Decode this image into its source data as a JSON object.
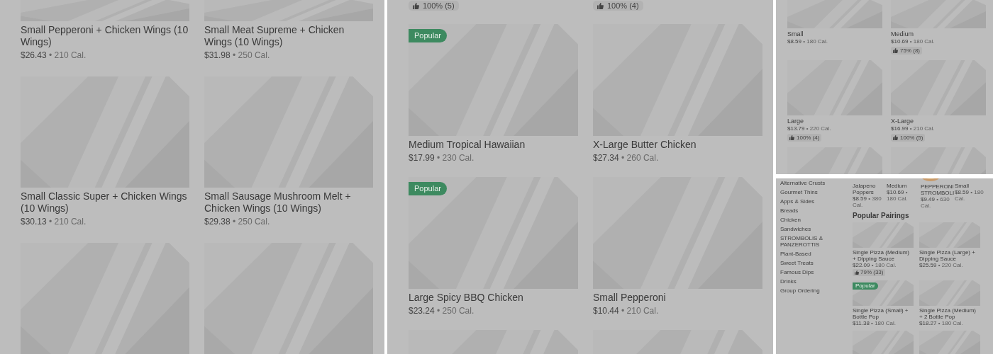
{
  "panels": [
    {
      "kind": "grid",
      "rows": [
        [
          {
            "kind": "card",
            "name": "Small Pepperoni + Chicken Wings (10 Wings)",
            "price": "$26.43",
            "calories": "• 210 Cal."
          },
          {
            "kind": "card",
            "name": "Small Meat Supreme + Chicken Wings (10 Wings)",
            "price": "$31.98",
            "calories": "• 250 Cal."
          }
        ],
        [
          {
            "kind": "card",
            "name": "Small Classic Super + Chicken Wings (10 Wings)",
            "price": "$30.13",
            "calories": "• 210 Cal."
          },
          {
            "kind": "card",
            "name": "Small Sausage Mushroom Melt + Chicken Wings (10 Wings)",
            "price": "$29.38",
            "calories": "• 250 Cal."
          }
        ],
        [
          {
            "kind": "image_only"
          },
          {
            "kind": "image_only"
          }
        ]
      ]
    },
    {
      "kind": "grid",
      "rows": [
        [
          {
            "kind": "rating_only",
            "rating": "100% (5)"
          },
          {
            "kind": "rating_only",
            "rating": "100% (4)"
          }
        ],
        [
          {
            "kind": "card",
            "badge": "Popular",
            "name": "Medium Tropical Hawaiian",
            "price": "$17.99",
            "calories": "• 230 Cal."
          },
          {
            "kind": "card",
            "name": "X-Large Butter Chicken",
            "price": "$27.34",
            "calories": "• 260 Cal."
          }
        ],
        [
          {
            "kind": "card",
            "badge": "Popular",
            "name": "Large Spicy BBQ Chicken",
            "price": "$23.24",
            "calories": "• 250 Cal."
          },
          {
            "kind": "card",
            "name": "Small Pepperoni",
            "price": "$10.44",
            "calories": "• 210 Cal."
          }
        ],
        [
          {
            "kind": "image_only"
          },
          {
            "kind": "image_only"
          }
        ]
      ]
    },
    {
      "kind": "grid",
      "rows": [
        [
          {
            "kind": "card",
            "name": "Small",
            "price": "$8.59",
            "calories": "• 180 Cal."
          },
          {
            "kind": "card",
            "name": "Medium",
            "price": "$10.69",
            "calories": "• 180 Cal.",
            "rating": "75% (8)"
          }
        ],
        [
          {
            "kind": "card",
            "name": "Large",
            "price": "$13.79",
            "calories": "• 220 Cal.",
            "rating": "100% (4)"
          },
          {
            "kind": "card",
            "name": "X-Large",
            "price": "$16.99",
            "calories": "• 210 Cal.",
            "rating": "100% (5)"
          }
        ],
        [
          {
            "kind": "image_only"
          },
          {
            "kind": "image_only"
          }
        ]
      ]
    },
    {
      "kind": "menu",
      "sidebar": [
        "Alternative Crusts",
        "Gourmet Thins",
        "Apps & Sides",
        "Breads",
        "Chicken",
        "Sandwiches",
        "STROMBOLIS & PANZEROTTIS",
        "Plant-Based",
        "Sweet Treats",
        "Famous Dips",
        "Drinks",
        "Group Ordering"
      ],
      "top_items": [
        {
          "name": "Jalapeno Poppers",
          "price": "$8.59",
          "calories": "• 380 Cal."
        },
        {
          "name": "Medium",
          "price": "$10.69",
          "calories": "• 180 Cal."
        },
        {
          "name": "PEPPERONI STROMBOLI",
          "price": "$9.49",
          "calories": "• 630 Cal."
        },
        {
          "name": "Small",
          "price": "$8.59",
          "calories": "• 180 Cal."
        }
      ],
      "section_title": "Popular Pairings",
      "rows": [
        [
          {
            "kind": "card",
            "name": "Single Pizza (Medium) + Dipping Sauce",
            "price": "$22.09",
            "calories": "• 180 Cal.",
            "rating": "79% (33)"
          },
          {
            "kind": "card",
            "name": "Single Pizza (Large) + Dipping Sauce",
            "price": "$25.59",
            "calories": "• 220 Cal."
          }
        ],
        [
          {
            "kind": "card",
            "badge": "Popular",
            "name": "Single Pizza (Small) + Bottle Pop",
            "price": "$11.38",
            "calories": "• 180 Cal."
          },
          {
            "kind": "card",
            "name": "Single Pizza (Medium) + 2 Bottle Pop",
            "price": "$18.27",
            "calories": "• 180 Cal."
          }
        ],
        [
          {
            "kind": "image_only"
          },
          {
            "kind": "image_only"
          }
        ]
      ]
    }
  ]
}
